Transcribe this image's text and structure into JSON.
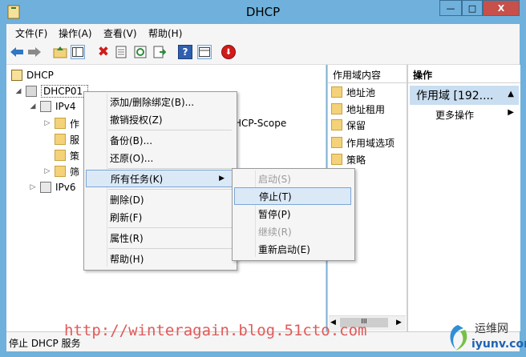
{
  "window": {
    "title": "DHCP",
    "controls": {
      "minimize": "—",
      "maximize": "□",
      "close": "X"
    }
  },
  "menubar": [
    "文件(F)",
    "操作(A)",
    "查看(V)",
    "帮助(H)"
  ],
  "toolbar": {
    "icons": [
      "back-icon",
      "forward-icon",
      "up-folder-icon",
      "show-tree-icon",
      "delete-icon",
      "properties-icon",
      "refresh-icon",
      "export-icon",
      "help-icon",
      "view-icon",
      "stop-service-icon"
    ],
    "delete_glyph": "✖",
    "help_glyph": "?",
    "stop_glyph": "⬇"
  },
  "tree": {
    "root": "DHCP",
    "server": "DHCP01.",
    "ipv4": "IPv4",
    "ipv4_children": [
      "作",
      "服",
      "策",
      "筛"
    ],
    "scope_tail": "HCP-Scope",
    "ipv6": "IPv6"
  },
  "middle": {
    "header": "作用域内容",
    "items": [
      "地址池",
      "地址租用",
      "保留",
      "作用域选项",
      "策略"
    ],
    "scroll_thumb": "III"
  },
  "actions": {
    "header": "操作",
    "selected": "作用域 [192....",
    "more": "更多操作"
  },
  "context_menu": {
    "items": [
      "添加/删除绑定(B)...",
      "撤销授权(Z)",
      "备份(B)...",
      "还原(O)...",
      "所有任务(K)",
      "删除(D)",
      "刷新(F)",
      "属性(R)",
      "帮助(H)"
    ]
  },
  "submenu": {
    "items": [
      "启动(S)",
      "停止(T)",
      "暂停(P)",
      "继续(R)",
      "重新启动(E)"
    ],
    "disabled": [
      0,
      3
    ],
    "highlighted": 1
  },
  "status_text": "停止 DHCP 服务",
  "watermark": "http://winteragain.blog.51cto.com",
  "logo": {
    "title": "运维网",
    "url": "iyunv.com"
  }
}
